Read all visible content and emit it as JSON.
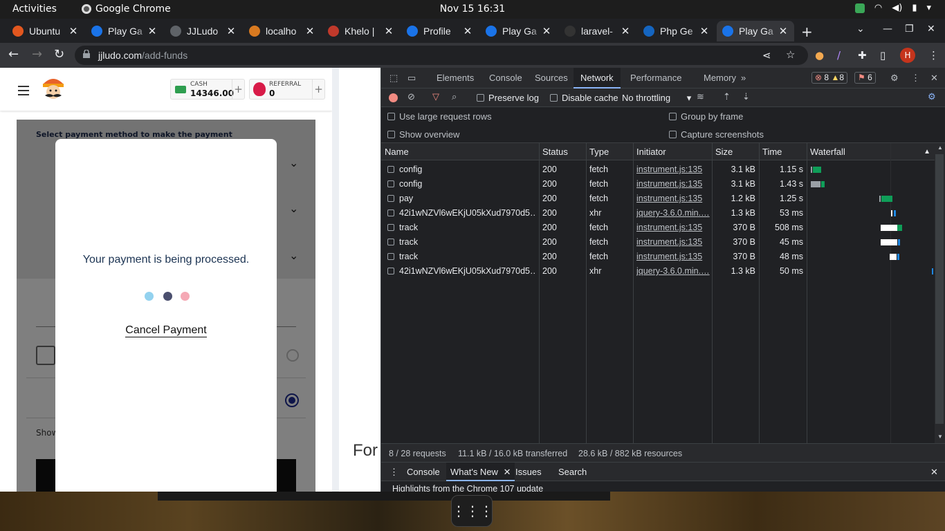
{
  "topbar": {
    "activities": "Activities",
    "app_name": "Google Chrome",
    "clock": "Nov 15  16:31"
  },
  "tabs": [
    {
      "title": "Ubuntu",
      "fav_color": "#e2571f"
    },
    {
      "title": "Play Ga",
      "fav_color": "#1a73e8"
    },
    {
      "title": "JJLudo",
      "fav_color": "#5f6368"
    },
    {
      "title": "localho",
      "fav_color": "#d97a20"
    },
    {
      "title": "Khelo |",
      "fav_color": "#c0392b"
    },
    {
      "title": "Profile",
      "fav_color": "#1a73e8"
    },
    {
      "title": "Play Ga",
      "fav_color": "#1a73e8"
    },
    {
      "title": "laravel-",
      "fav_color": "#333333"
    },
    {
      "title": "Php Ge",
      "fav_color": "#1565c0"
    },
    {
      "title": "Play Ga",
      "fav_color": "#1a73e8"
    }
  ],
  "address": {
    "domain": "jjludo.com",
    "path": "/add-funds"
  },
  "profile_initial": "H",
  "site": {
    "cash_label": "CASH",
    "cash_value": "14346.00",
    "referral_label": "REFERRAL",
    "referral_value": "0",
    "payment_title": "Select payment method to make the payment",
    "show_text": "Show",
    "for_text": "For"
  },
  "modal": {
    "message": "Your payment is being processed.",
    "cancel": "Cancel Payment",
    "dot_colors": [
      "#93d2ef",
      "#4b4f6e",
      "#f5a9b5"
    ]
  },
  "devtools": {
    "tabs": [
      "Elements",
      "Console",
      "Sources",
      "Network",
      "Performance",
      "Memory"
    ],
    "active_tab": "Network",
    "errors": "8",
    "warnings": "8",
    "issues": "6",
    "preserve_log": "Preserve log",
    "disable_cache": "Disable cache",
    "throttling": "No throttling",
    "options": {
      "large_rows": "Use large request rows",
      "show_overview": "Show overview",
      "group_by_frame": "Group by frame",
      "capture_screenshots": "Capture screenshots"
    },
    "columns": [
      "Name",
      "Status",
      "Type",
      "Initiator",
      "Size",
      "Time",
      "Waterfall"
    ],
    "requests": [
      {
        "name": "config",
        "status": "200",
        "type": "fetch",
        "initiator": "instrument.js:135",
        "size": "3.1 kB",
        "time": "1.15 s"
      },
      {
        "name": "config",
        "status": "200",
        "type": "fetch",
        "initiator": "instrument.js:135",
        "size": "3.1 kB",
        "time": "1.43 s"
      },
      {
        "name": "pay",
        "status": "200",
        "type": "fetch",
        "initiator": "instrument.js:135",
        "size": "1.2 kB",
        "time": "1.25 s"
      },
      {
        "name": "42i1wNZVl6wEKjU05kXud7970d5…",
        "status": "200",
        "type": "xhr",
        "initiator": "jquery-3.6.0.min.…",
        "size": "1.3 kB",
        "time": "53 ms"
      },
      {
        "name": "track",
        "status": "200",
        "type": "fetch",
        "initiator": "instrument.js:135",
        "size": "370 B",
        "time": "508 ms"
      },
      {
        "name": "track",
        "status": "200",
        "type": "fetch",
        "initiator": "instrument.js:135",
        "size": "370 B",
        "time": "45 ms"
      },
      {
        "name": "track",
        "status": "200",
        "type": "fetch",
        "initiator": "instrument.js:135",
        "size": "370 B",
        "time": "48 ms"
      },
      {
        "name": "42i1wNZVl6wEKjU05kXud7970d5…",
        "status": "200",
        "type": "xhr",
        "initiator": "jquery-3.6.0.min.…",
        "size": "1.3 kB",
        "time": "50 ms"
      }
    ],
    "status": {
      "requests": "8 / 28 requests",
      "transferred": "11.1 kB / 16.0 kB transferred",
      "resources": "28.6 kB / 882 kB resources"
    },
    "drawer_tabs": [
      "Console",
      "What's New",
      "Issues",
      "Search"
    ],
    "drawer_active": "What's New",
    "drawer_text": "Highlights from the Chrome 107 update"
  }
}
